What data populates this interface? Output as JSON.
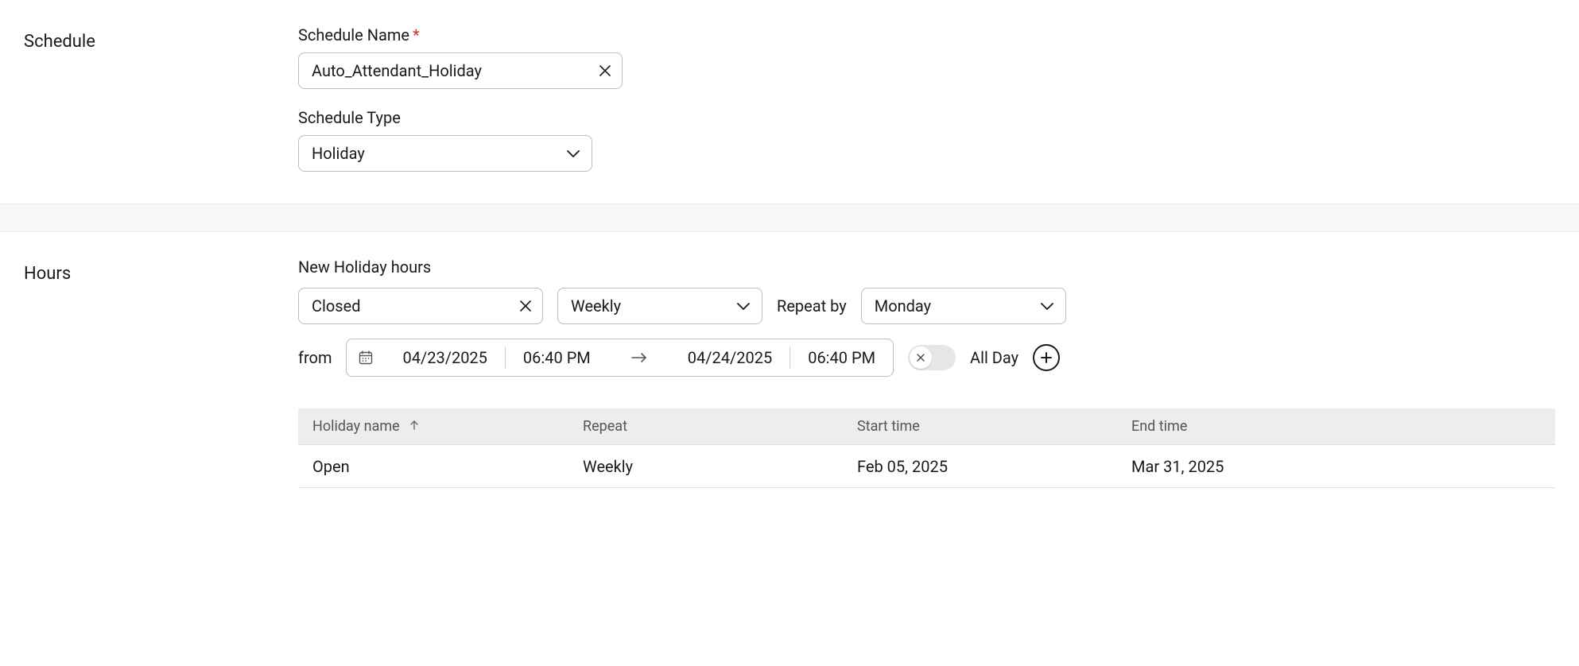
{
  "schedule": {
    "section_label": "Schedule",
    "name_label": "Schedule Name",
    "name_value": "Auto_Attendant_Holiday",
    "type_label": "Schedule Type",
    "type_value": "Holiday"
  },
  "hours": {
    "section_label": "Hours",
    "subheading": "New Holiday hours",
    "name_value": "Closed",
    "repeat_value": "Weekly",
    "repeat_by_label": "Repeat by",
    "day_value": "Monday",
    "from_label": "from",
    "start_date": "04/23/2025",
    "start_time": "06:40 PM",
    "end_date": "04/24/2025",
    "end_time": "06:40 PM",
    "all_day_label": "All Day"
  },
  "table": {
    "headers": {
      "name": "Holiday name",
      "repeat": "Repeat",
      "start": "Start time",
      "end": "End time"
    },
    "rows": [
      {
        "name": "Open",
        "repeat": "Weekly",
        "start": "Feb 05, 2025",
        "end": "Mar 31, 2025"
      }
    ]
  }
}
